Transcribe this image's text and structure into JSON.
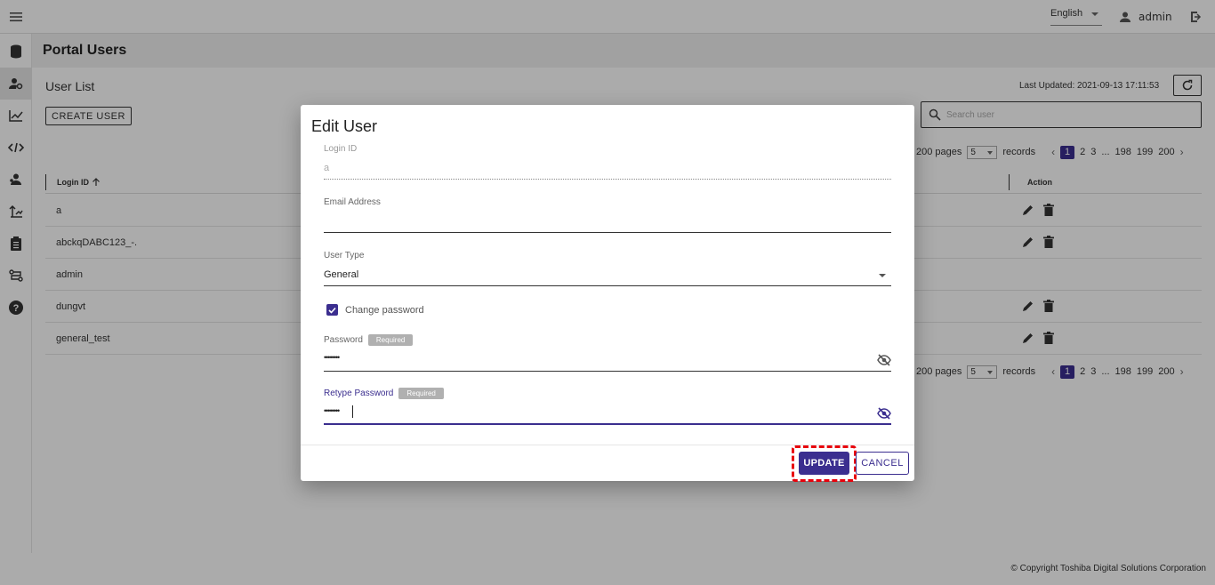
{
  "topbar": {
    "language": "English",
    "user": "admin"
  },
  "page": {
    "title": "Portal Users",
    "list_title": "User List",
    "last_updated": "Last Updated: 2021-09-13 17:11:53"
  },
  "toolbar": {
    "create_label": "CREATE USER",
    "search_placeholder": "Search user"
  },
  "pagination": {
    "pages_text": "200 pages",
    "page_size": "5",
    "records_label": "records",
    "pages": [
      "1",
      "2",
      "3",
      "...",
      "198",
      "199",
      "200"
    ],
    "current": "1"
  },
  "table": {
    "headers": {
      "login_id": "Login ID",
      "action": "Action"
    },
    "rows": [
      {
        "login_id": "a",
        "editable": true
      },
      {
        "login_id": "abckqDABC123_-.",
        "editable": true
      },
      {
        "login_id": "admin",
        "editable": false
      },
      {
        "login_id": "dungvt",
        "editable": true
      },
      {
        "login_id": "general_test",
        "editable": true
      }
    ]
  },
  "dialog": {
    "title": "Edit User",
    "login_id_label": "Login ID",
    "login_id_value": "a",
    "email_label": "Email Address",
    "email_value": "",
    "user_type_label": "User Type",
    "user_type_value": "General",
    "change_password_label": "Change password",
    "password_label": "Password",
    "retype_label": "Retype Password",
    "required_badge": "Required",
    "password_mask": "••••••••",
    "update_label": "UPDATE",
    "cancel_label": "CANCEL"
  },
  "footer": {
    "copyright": "© Copyright Toshiba Digital Solutions Corporation"
  },
  "colors": {
    "accent": "#3b2e8f",
    "highlight": "#e8000b"
  }
}
